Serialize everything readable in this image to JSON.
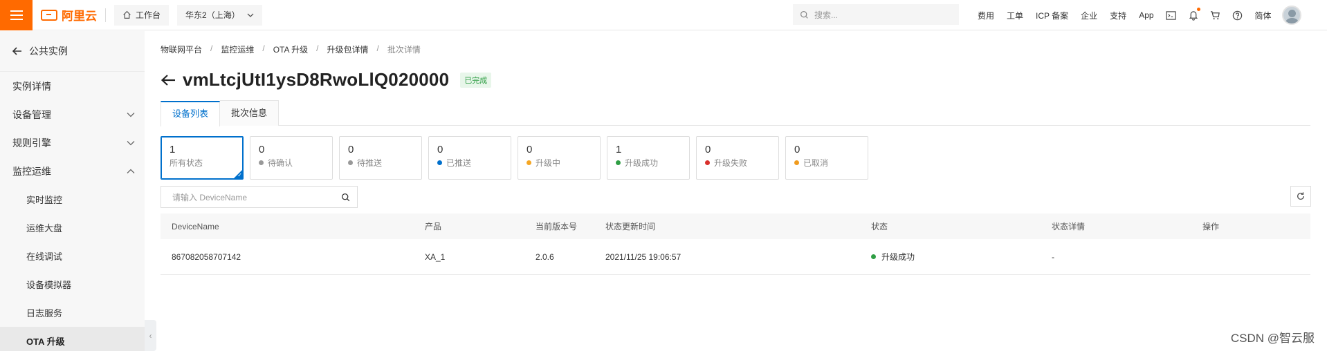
{
  "header": {
    "logo_text": "阿里云",
    "workbench_label": "工作台",
    "region_label": "华东2（上海）",
    "search_placeholder": "搜索...",
    "links": [
      "费用",
      "工单",
      "ICP 备案",
      "企业",
      "支持",
      "App"
    ],
    "lang_label": "简体",
    "accent_color": "#ff6a00"
  },
  "sidebar": {
    "back_label": "公共实例",
    "items": [
      {
        "label": "实例详情",
        "chevron": ""
      },
      {
        "label": "设备管理",
        "chevron": "down"
      },
      {
        "label": "规则引擎",
        "chevron": "down"
      },
      {
        "label": "监控运维",
        "chevron": "up"
      }
    ],
    "sub_items": [
      {
        "label": "实时监控",
        "active": false
      },
      {
        "label": "运维大盘",
        "active": false
      },
      {
        "label": "在线调试",
        "active": false
      },
      {
        "label": "设备模拟器",
        "active": false
      },
      {
        "label": "日志服务",
        "active": false
      },
      {
        "label": "OTA 升级",
        "active": true
      }
    ]
  },
  "breadcrumb": [
    "物联网平台",
    "监控运维",
    "OTA 升级",
    "升级包详情",
    "批次详情"
  ],
  "page": {
    "title": "vmLtcjUtI1ysD8RwoLlQ020000",
    "status_badge": "已完成"
  },
  "tabs": [
    {
      "label": "设备列表",
      "active": true
    },
    {
      "label": "批次信息",
      "active": false
    }
  ],
  "stats": [
    {
      "count": "1",
      "label": "所有状态",
      "dot": "",
      "active": true
    },
    {
      "count": "0",
      "label": "待确认",
      "dot": "#999999",
      "active": false
    },
    {
      "count": "0",
      "label": "待推送",
      "dot": "#999999",
      "active": false
    },
    {
      "count": "0",
      "label": "已推送",
      "dot": "#0070cc",
      "active": false
    },
    {
      "count": "0",
      "label": "升级中",
      "dot": "#f5a623",
      "active": false
    },
    {
      "count": "1",
      "label": "升级成功",
      "dot": "#2f9e44",
      "active": false
    },
    {
      "count": "0",
      "label": "升级失败",
      "dot": "#d9302c",
      "active": false
    },
    {
      "count": "0",
      "label": "已取消",
      "dot": "#f09b1e",
      "active": false
    }
  ],
  "filter": {
    "placeholder": "请输入 DeviceName"
  },
  "table": {
    "columns": [
      "DeviceName",
      "产品",
      "当前版本号",
      "状态更新时间",
      "状态",
      "状态详情",
      "操作"
    ],
    "rows": [
      {
        "device_name": "867082058707142",
        "product": "XA_1",
        "version": "2.0.6",
        "updated_at": "2021/11/25 19:06:57",
        "status": "升级成功",
        "status_detail": "-",
        "action": ""
      }
    ]
  },
  "watermark": "CSDN @智云服"
}
